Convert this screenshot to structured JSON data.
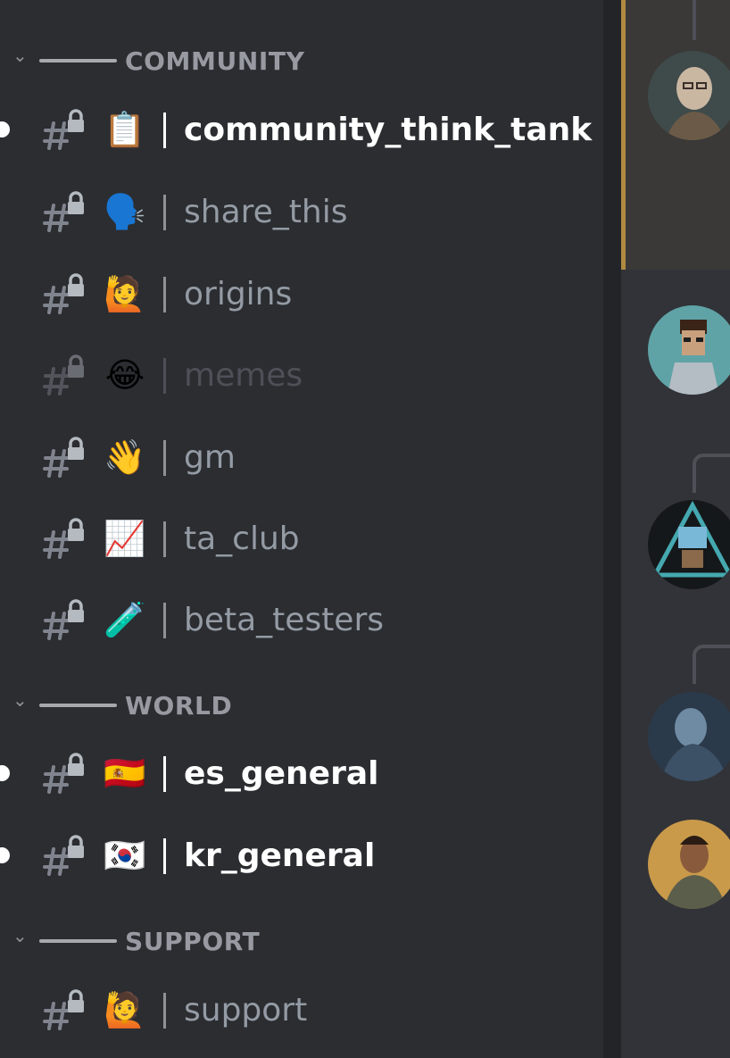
{
  "categories": {
    "community": {
      "label": "COMMUNITY",
      "chevron": "chevron-down-icon"
    },
    "world": {
      "label": "WORLD",
      "chevron": "chevron-down-icon"
    },
    "support": {
      "label": "SUPPORT",
      "chevron": "chevron-down-icon"
    }
  },
  "channels": {
    "community_think_tank": {
      "name": "community_think_tank",
      "emoji": "📋",
      "unread": true
    },
    "share_this": {
      "name": "share_this",
      "emoji": "🗣️"
    },
    "origins": {
      "name": "origins",
      "emoji": "🙋"
    },
    "memes": {
      "name": "memes",
      "emoji": "😂",
      "muted": true
    },
    "gm": {
      "name": "gm",
      "emoji": "👋"
    },
    "ta_club": {
      "name": "ta_club",
      "emoji": "📈"
    },
    "beta_testers": {
      "name": "beta_testers",
      "emoji": "🧪"
    },
    "es_general": {
      "name": "es_general",
      "emoji": "🇪🇸",
      "unread": true
    },
    "kr_general": {
      "name": "kr_general",
      "emoji": "🇰🇷",
      "unread": true
    },
    "support": {
      "name": "support",
      "emoji": "🙋"
    }
  },
  "icons": {
    "channel_icon": "locked-text-channel-icon",
    "avatar": "user-avatar-icon"
  },
  "colors": {
    "sidebar_bg": "#2b2d31",
    "chat_bg": "#313338",
    "unread_text": "#ffffff",
    "channel_text": "#949ba4",
    "muted_text": "#4e5058",
    "highlight_accent": "#b08a42"
  }
}
